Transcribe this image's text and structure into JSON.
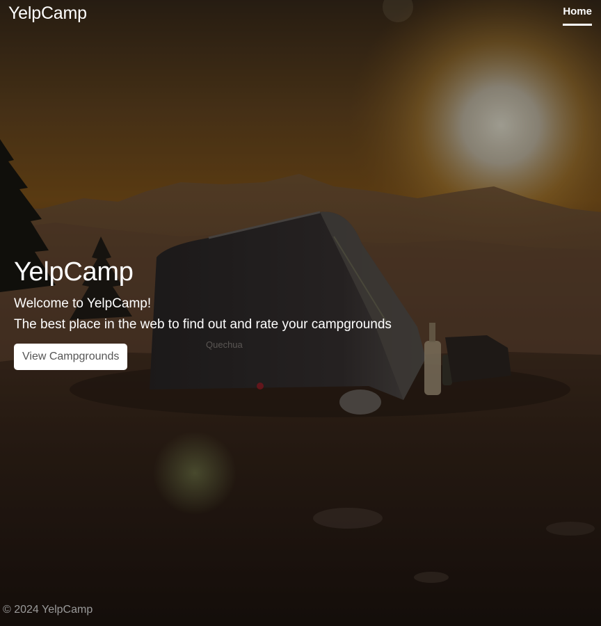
{
  "header": {
    "brand": "YelpCamp",
    "nav": [
      {
        "label": "Home",
        "active": true
      }
    ]
  },
  "hero": {
    "title": "YelpCamp",
    "lines": [
      "Welcome to YelpCamp!",
      "The best place in the web to find out and rate your campgrounds"
    ],
    "button_label": "View Campgrounds"
  },
  "background": {
    "tent_brand": "Quechua"
  },
  "footer": {
    "copyright": "© 2024 YelpCamp"
  },
  "colors": {
    "text": "#ffffff",
    "button_bg": "#ffffff",
    "button_text": "#555555",
    "footer_text": "#9a9a9a",
    "sky_top": "#3a2a1a",
    "sun": "#e9e2c8"
  }
}
